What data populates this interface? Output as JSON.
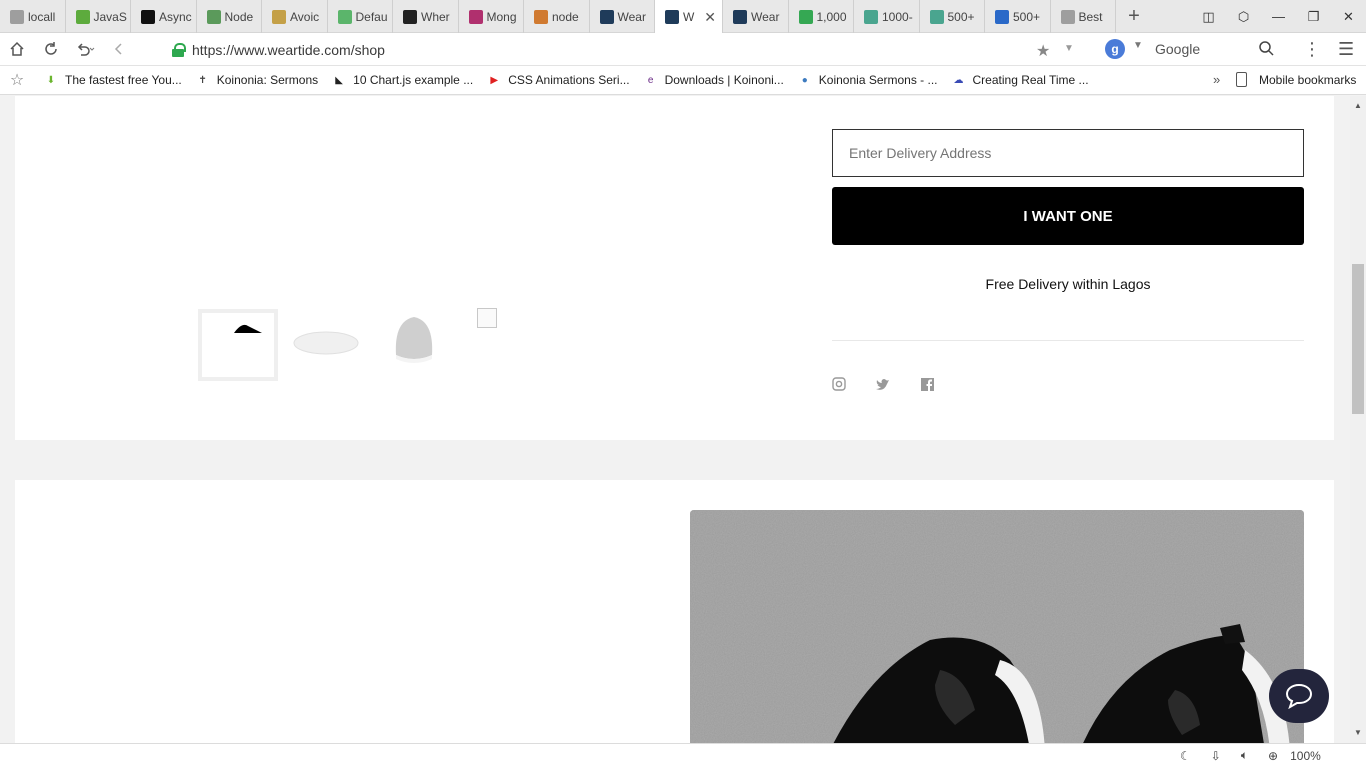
{
  "browser": {
    "tabs": [
      {
        "label": "locall",
        "icon": "page-icon",
        "color": "#9e9e9e"
      },
      {
        "label": "JavaS",
        "icon": "w3schools-icon",
        "color": "#5dab3d"
      },
      {
        "label": "Async",
        "icon": "dev-icon",
        "color": "#111111"
      },
      {
        "label": "Node",
        "icon": "node-icon",
        "color": "#5b9a5b"
      },
      {
        "label": "Avoic",
        "icon": "sun-icon",
        "color": "#c4a047"
      },
      {
        "label": "Defau",
        "icon": "shield-icon",
        "color": "#5bb56b"
      },
      {
        "label": "Wher",
        "icon": "quill-icon",
        "color": "#222222"
      },
      {
        "label": "Mong",
        "icon": "medium-icon",
        "color": "#b0306e"
      },
      {
        "label": "node",
        "icon": "stack-icon",
        "color": "#d07a30"
      },
      {
        "label": "Wear",
        "icon": "react-icon",
        "color": "#1f3b5a"
      },
      {
        "label": "W",
        "icon": "react-icon",
        "color": "#1f3b5a",
        "active": true
      },
      {
        "label": "Wear",
        "icon": "react-icon",
        "color": "#1f3b5a"
      },
      {
        "label": "1,000",
        "icon": "px-icon",
        "color": "#35a853"
      },
      {
        "label": "1000-",
        "icon": "d-icon",
        "color": "#4aa58f"
      },
      {
        "label": "500+",
        "icon": "d-icon",
        "color": "#4aa58f"
      },
      {
        "label": "500+",
        "icon": "spinner-icon",
        "color": "#2a69c8"
      },
      {
        "label": "Best",
        "icon": "page-icon",
        "color": "#9e9e9e"
      }
    ],
    "url": "https://www.weartide.com/shop",
    "search_engine_label": "Google",
    "bookmarks": [
      {
        "label": "The fastest free You...",
        "icon": "download-arrow-icon"
      },
      {
        "label": "Koinonia: Sermons",
        "icon": "cross-icon"
      },
      {
        "label": "10 Chart.js example ...",
        "icon": "dark-logo-icon"
      },
      {
        "label": "CSS Animations Seri...",
        "icon": "youtube-icon"
      },
      {
        "label": "Downloads | Koinoni...",
        "icon": "eni-icon"
      },
      {
        "label": "Koinonia Sermons - ...",
        "icon": "globe-icon"
      },
      {
        "label": "Creating Real Time ...",
        "icon": "cloud-icon"
      }
    ],
    "mobile_bookmarks_label": "Mobile bookmarks",
    "zoom": "100%"
  },
  "product": {
    "address_placeholder": "Enter Delivery Address",
    "cta_label": "I WANT ONE",
    "delivery_note": "Free Delivery within Lagos"
  }
}
